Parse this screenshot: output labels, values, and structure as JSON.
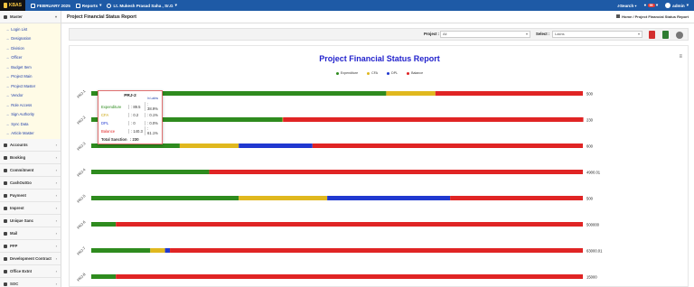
{
  "topbar": {
    "brand": "KBAS",
    "period": "FEBRUARY 2025",
    "reports_label": "Reports",
    "user_name": "Lt. Mukesh Prasad Saha , Sr.G",
    "search_label": "Search",
    "notif_count": "99",
    "admin_label": "admin"
  },
  "sidebar": {
    "master": "Master",
    "master_items": [
      "Login List",
      "Designation",
      "Division",
      "Officer",
      "Budget Item",
      "Project Main",
      "Project Master",
      "Vendor",
      "Role Access",
      "Sign Authority",
      "Sync Data",
      "Article Master"
    ],
    "sections": [
      "Accounts",
      "Booking",
      "Commitment",
      "CashOutGo",
      "Payment",
      "Imprest",
      "Unique Sanc",
      "Mail",
      "PFP",
      "Development Contract",
      "Office Extnt",
      "SOC"
    ]
  },
  "page": {
    "title": "Project Financial Status Report",
    "crumb_home": "Home",
    "crumb_current": "Project Financial Status Report"
  },
  "filters": {
    "project_label": "Project :",
    "project_value": "All",
    "select_label": "Select :",
    "select_value": "Lakhs"
  },
  "colors": {
    "expenditure": "#2e8b1e",
    "cfa": "#e0b81e",
    "dpl": "#2038d0",
    "balance": "#e02424"
  },
  "chart_data": {
    "type": "bar",
    "title": "Project Financial Status Report",
    "legend_position": "top",
    "series_names": [
      "Expenditure",
      "CFA",
      "DPL",
      "Balance"
    ],
    "categories": [
      "PRJ-1",
      "PRJ-2",
      "PRJ-3",
      "PRJ-4",
      "PRJ-5",
      "PRJ-6",
      "PRJ-7",
      "PRJ-8"
    ],
    "totals": [
      "500",
      "230",
      "600",
      "4900.01",
      "500",
      "500000",
      "63000.01",
      "15000"
    ],
    "percent": [
      [
        60.0,
        10.0,
        0.0,
        30.0
      ],
      [
        38.9,
        0.1,
        0.0,
        61.1
      ],
      [
        18.0,
        12.0,
        15.0,
        55.0
      ],
      [
        24.0,
        0.0,
        0.0,
        76.0
      ],
      [
        30.0,
        18.0,
        25.0,
        27.0
      ],
      [
        5.0,
        0.0,
        0.0,
        95.0
      ],
      [
        12.0,
        3.0,
        1.0,
        84.0
      ],
      [
        5.0,
        0.0,
        0.0,
        95.0
      ]
    ]
  },
  "tooltip": {
    "title": "PRJ-2",
    "unit": "In Lakhs",
    "rows": [
      {
        "label": "Expenditure",
        "value": ": 89.5",
        "pct": ": 38.9%",
        "color": "#2e8b1e"
      },
      {
        "label": "CFA",
        "value": ": 0.2",
        "pct": ": 0.1%",
        "color": "#c8a200"
      },
      {
        "label": "DPL",
        "value": ": 0",
        "pct": ": 0.0%",
        "color": "#2038d0"
      },
      {
        "label": "Balance",
        "value": ": 140.3",
        "pct": ": 61.1%",
        "color": "#e02424"
      }
    ],
    "total_label": "Total Sanction",
    "total_value": ": 230"
  }
}
